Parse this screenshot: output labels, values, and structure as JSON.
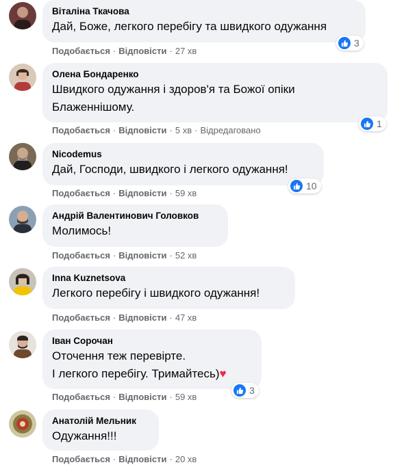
{
  "labels": {
    "like": "Подобається",
    "reply": "Відповісти",
    "dot": "·"
  },
  "colors": {
    "like_badge": "#1877f2",
    "bubble": "#f0f2f5",
    "meta": "#65676b",
    "heart": "#f02849"
  },
  "comments": [
    {
      "author": "Віталіна Ткачова",
      "lines": [
        "Дай, Боже, легкого перебігу та швидкого одужання"
      ],
      "time": "27 хв",
      "reactions": "3",
      "avatar": "profile-photo"
    },
    {
      "author": "Олена Бондаренко",
      "lines": [
        "Швидкого одужання і здоров'я та Божої опіки",
        "Блаженнішому."
      ],
      "time": "5 хв",
      "edited": "Відредаговано",
      "reactions": "1",
      "avatar": "profile-photo"
    },
    {
      "author": "Nicodemus",
      "lines": [
        "Дай, Господи, швидкого і легкого одужання!"
      ],
      "time": "59 хв",
      "reactions": "10",
      "avatar": "profile-photo"
    },
    {
      "author": "Андрій Валентинович Головков",
      "lines": [
        "Молимось!"
      ],
      "time": "52 хв",
      "avatar": "profile-photo"
    },
    {
      "author": "Inna Kuznetsova",
      "lines": [
        "Легкого перебігу і швидкого одужання!"
      ],
      "time": "47 хв",
      "avatar": "profile-photo"
    },
    {
      "author": "Іван Сорочан",
      "lines": [
        "Оточення теж перевірте.",
        "І легкого перебігу. Тримайтесь)"
      ],
      "time": "59 хв",
      "reactions": "3",
      "emoji": "heart-emoji",
      "avatar": "profile-photo"
    },
    {
      "author": "Анатолій Мельник",
      "lines": [
        "Одужання!!!"
      ],
      "time": "20 хв",
      "avatar": "profile-photo"
    }
  ]
}
